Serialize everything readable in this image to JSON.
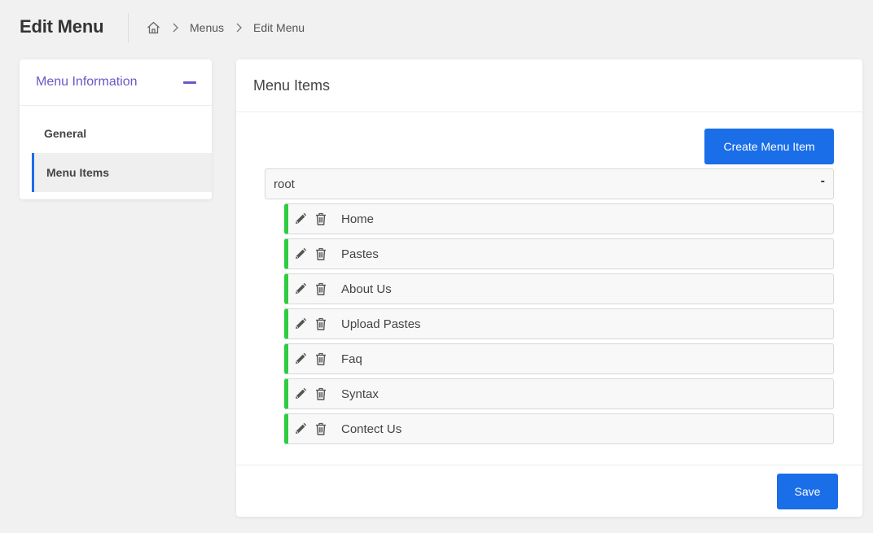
{
  "header": {
    "title": "Edit Menu",
    "breadcrumb": {
      "home_icon": "home-icon",
      "items": [
        "Menus",
        "Edit Menu"
      ]
    }
  },
  "sidebar": {
    "title": "Menu Information",
    "collapse_icon": "minus-icon",
    "items": [
      {
        "label": "General",
        "active": false
      },
      {
        "label": "Menu Items",
        "active": true
      }
    ]
  },
  "main": {
    "title": "Menu Items",
    "create_label": "Create Menu Item",
    "root": {
      "label": "root",
      "toggle": "-"
    },
    "items": [
      {
        "label": "Home"
      },
      {
        "label": "Pastes"
      },
      {
        "label": "About Us"
      },
      {
        "label": "Upload Pastes"
      },
      {
        "label": "Faq"
      },
      {
        "label": "Syntax"
      },
      {
        "label": "Contect Us"
      }
    ],
    "save_label": "Save"
  },
  "colors": {
    "accent": "#1a6ee8",
    "sidebar_title": "#6b57c8",
    "item_border": "#2ecc40"
  },
  "icons": {
    "edit": "pencil-icon",
    "delete": "trash-icon"
  }
}
